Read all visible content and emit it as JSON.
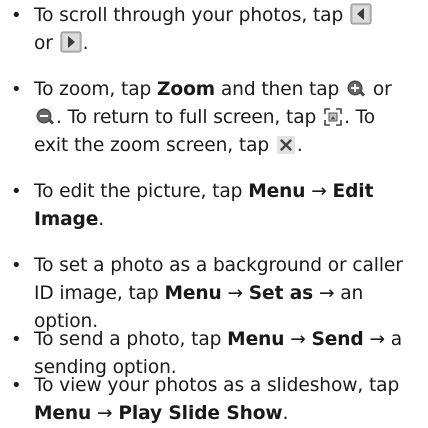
{
  "bullets": [
    {
      "pre": "To scroll through your photos, tap",
      "mid": "or",
      "post": "."
    },
    {
      "pre": "To zoom, tap",
      "b1": "Zoom",
      "m1": "and then tap",
      "m2": "or",
      "m3": ". To return to full screen, tap",
      "m4": ". To exit the zoom screen, tap",
      "post": "."
    },
    {
      "pre": "To edit the picture, tap",
      "b1": "Menu",
      "arrow": "→",
      "b2": "Edit Image",
      "post": "."
    },
    {
      "pre": "To set a photo as a background or caller ID image, tap",
      "b1": "Menu",
      "arrow1": "→",
      "b2": "Set as",
      "arrow2": "→",
      "post": "an option."
    },
    {
      "pre": "To send a photo, tap",
      "b1": "Menu",
      "arrow1": "→",
      "b2": "Send",
      "arrow2": "→",
      "post": "a sending option."
    },
    {
      "pre": "To view your photos as a slideshow, tap",
      "b1": "Menu",
      "arrow": "→",
      "b2": "Play Slide Show",
      "post": "."
    }
  ],
  "icons": {
    "previous": "previous-arrow-icon",
    "next": "next-arrow-icon",
    "zoom_in": "zoom-in-icon",
    "zoom_out": "zoom-out-icon",
    "full_screen": "full-screen-icon",
    "close": "close-icon"
  },
  "colors": {
    "text": "#1a1a1a",
    "icon_dark": "#555555",
    "icon_tile": "#d8d8d8"
  }
}
